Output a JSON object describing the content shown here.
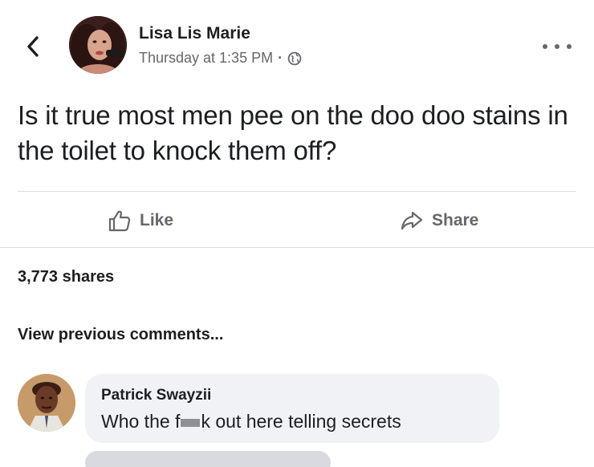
{
  "post": {
    "author": "Lisa Lis Marie",
    "timestamp": "Thursday at 1:35 PM",
    "separator": "·",
    "audience_icon": "globe-icon",
    "text": "Is it true most men pee on the doo doo stains in the toilet to knock them off?"
  },
  "actions": {
    "like_label": "Like",
    "share_label": "Share"
  },
  "stats": {
    "shares": "3,773 shares"
  },
  "comments": {
    "view_previous": "View previous comments...",
    "items": [
      {
        "author": "Patrick Swayzii",
        "text_before": "Who the f",
        "text_after": "k out here telling secrets"
      }
    ]
  },
  "colors": {
    "text_primary": "#1c1e21",
    "text_secondary": "#65676b",
    "divider": "#dadde1",
    "bubble": "#f0f2f5"
  }
}
